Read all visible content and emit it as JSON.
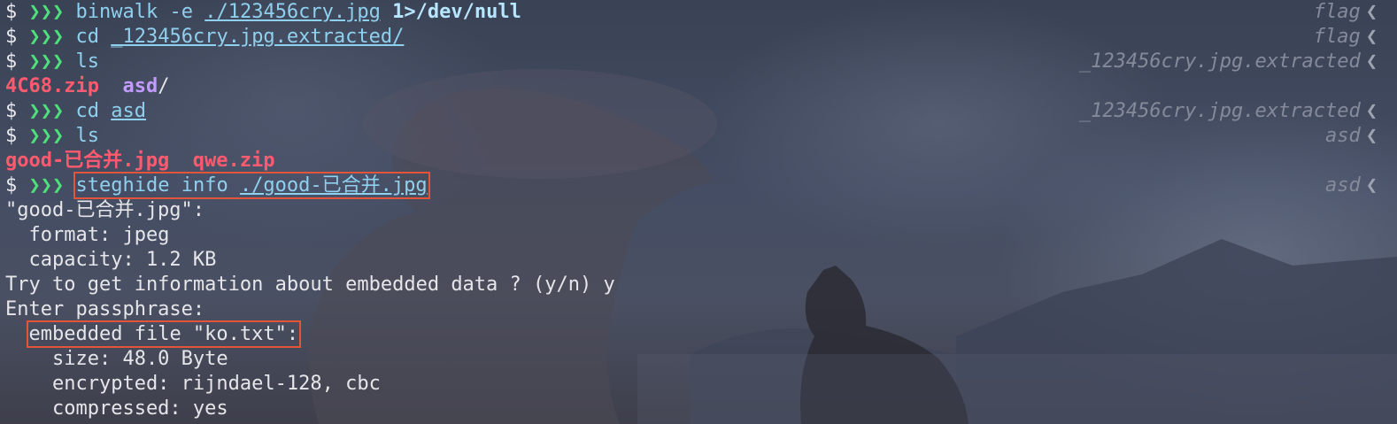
{
  "lines": [
    {
      "prompt": "$",
      "arrows": "❯❯❯",
      "cmd": "binwalk",
      "flag": "-e",
      "path": "./123456cry.jpg",
      "redir": "1>/dev/null",
      "right": "flag"
    },
    {
      "prompt": "$",
      "arrows": "❯❯❯",
      "cmd": "cd",
      "path": "_123456cry.jpg.extracted/",
      "right": "flag"
    },
    {
      "prompt": "$",
      "arrows": "❯❯❯",
      "cmd": "ls",
      "right": "_123456cry.jpg.extracted"
    },
    {
      "zip": "4C68.zip",
      "dir": "asd",
      "dir_slash": "/"
    },
    {
      "prompt": "$",
      "arrows": "❯❯❯",
      "cmd": "cd",
      "path": "asd",
      "right": "_123456cry.jpg.extracted"
    },
    {
      "prompt": "$",
      "arrows": "❯❯❯",
      "cmd": "ls",
      "right": "asd"
    },
    {
      "jpg": "good-已合并.jpg",
      "zip": "qwe.zip"
    },
    {
      "prompt": "$",
      "arrows": "❯❯❯",
      "cmd": "steghide info",
      "path": "./good-已合并.jpg",
      "right": "asd"
    },
    {
      "text": "\"good-已合并.jpg\":"
    },
    {
      "text": "  format: jpeg"
    },
    {
      "text": "  capacity: 1.2 KB"
    },
    {
      "text": "Try to get information about embedded data ? (y/n) y"
    },
    {
      "text": "Enter passphrase:"
    },
    {
      "text": "embedded file \"ko.txt\":"
    },
    {
      "text": "    size: 48.0 Byte"
    },
    {
      "text": "    encrypted: rijndael-128, cbc"
    },
    {
      "text": "    compressed: yes"
    }
  ],
  "right_chevron": "❮",
  "colors": {
    "prompt_arrows": "#4ee07a",
    "command": "#8fd0ef",
    "zip": "#ff5a6e",
    "directory": "#c39bff",
    "highlight_box": "#e2553a"
  }
}
